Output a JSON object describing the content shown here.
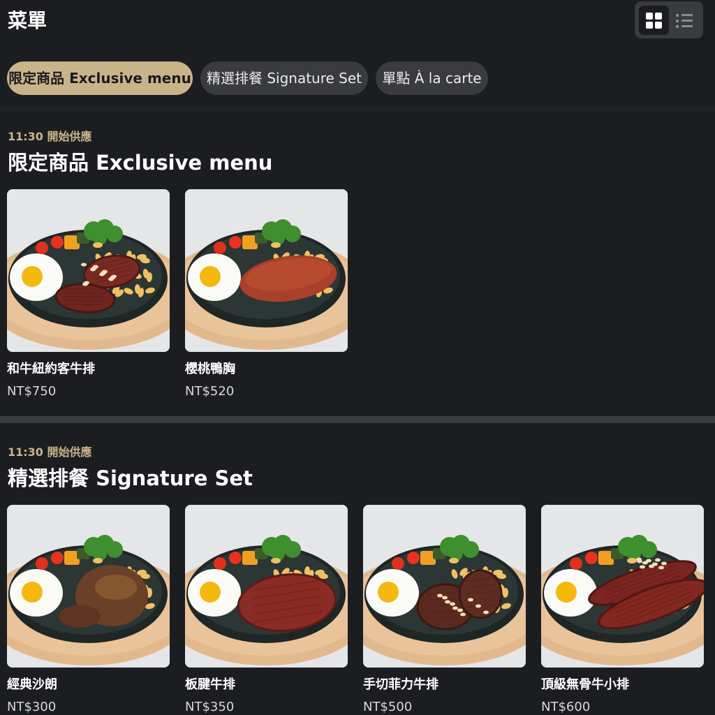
{
  "header": {
    "title": "菜單",
    "view_modes": [
      {
        "name": "grid",
        "icon": "grid-view-icon",
        "selected": true
      },
      {
        "name": "list",
        "icon": "list-view-icon",
        "selected": false
      }
    ]
  },
  "tabs": [
    {
      "label": "限定商品 Exclusive menu",
      "active": true
    },
    {
      "label": "精選排餐 Signature Set",
      "active": false
    },
    {
      "label": "單點 À la carte",
      "active": false
    }
  ],
  "sections": [
    {
      "serve_time": "11:30 開始供應",
      "title": "限定商品 Exclusive menu",
      "items": [
        {
          "name": "和牛紐約客牛排",
          "price": "NT$750",
          "image": "wagyu-striploin-steak-plate"
        },
        {
          "name": "櫻桃鴨胸",
          "price": "NT$520",
          "image": "cherry-duck-breast-plate"
        }
      ]
    },
    {
      "serve_time": "11:30 開始供應",
      "title": "精選排餐 Signature Set",
      "items": [
        {
          "name": "經典沙朗",
          "price": "NT$300",
          "image": "classic-sirloin-plate"
        },
        {
          "name": "板腱牛排",
          "price": "NT$350",
          "image": "flat-iron-steak-plate"
        },
        {
          "name": "手切菲力牛排",
          "price": "NT$500",
          "image": "hand-cut-filet-plate"
        },
        {
          "name": "頂級無骨牛小排",
          "price": "NT$600",
          "image": "boneless-short-rib-plate"
        }
      ]
    }
  ],
  "colors": {
    "background": "#1c1d20",
    "accent_gold": "#c9b48a",
    "tab_inactive": "#3a3b3f",
    "text_primary": "#ffffff"
  }
}
